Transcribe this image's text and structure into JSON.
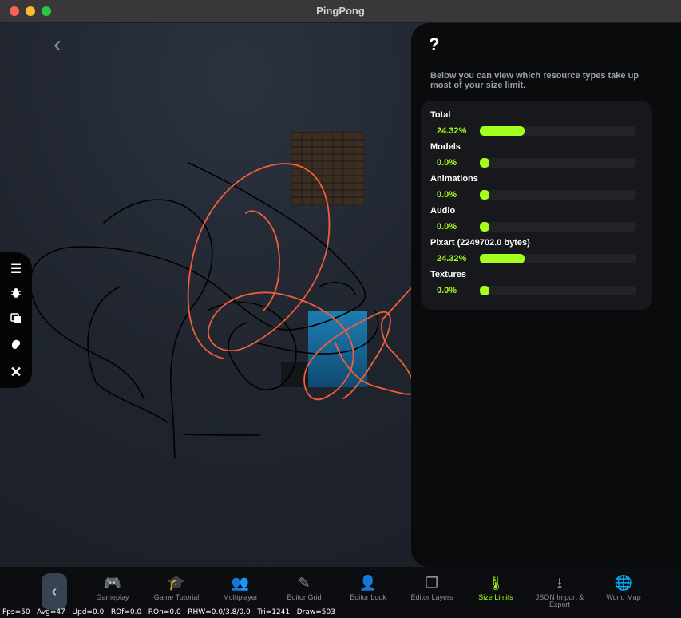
{
  "window": {
    "title": "PingPong"
  },
  "panel": {
    "help_label": "?",
    "description": "Below you can view which resource types take up most of your size limit.",
    "rows": [
      {
        "label": "Total",
        "percent_text": "24.32%",
        "fill_fraction": 0.2432
      },
      {
        "label": "Models",
        "percent_text": "0.0%",
        "fill_fraction": 0.0
      },
      {
        "label": "Animations",
        "percent_text": "0.0%",
        "fill_fraction": 0.0
      },
      {
        "label": "Audio",
        "percent_text": "0.0%",
        "fill_fraction": 0.0
      },
      {
        "label": "Pixart (2249702.0 bytes)",
        "percent_text": "24.32%",
        "fill_fraction": 0.2432
      },
      {
        "label": "Textures",
        "percent_text": "0.0%",
        "fill_fraction": 0.0
      }
    ],
    "accent_color": "#a4ff1c"
  },
  "side_toolbar": {
    "icons": [
      "menu-icon",
      "bug-icon",
      "copy-icon",
      "paint-icon",
      "close-icon"
    ]
  },
  "nav": {
    "back_icon": "chevron-left-icon",
    "items": [
      {
        "label": "Gameplay",
        "icon": "gamepad-icon"
      },
      {
        "label": "Game Tutorial",
        "icon": "graduation-cap-icon"
      },
      {
        "label": "Multiplayer",
        "icon": "users-icon"
      },
      {
        "label": "Editor Grid",
        "icon": "grid-edit-icon"
      },
      {
        "label": "Editor Look",
        "icon": "user-edit-icon"
      },
      {
        "label": "Editor Layers",
        "icon": "layers-icon"
      },
      {
        "label": "Size Limits",
        "icon": "thermometer-icon"
      },
      {
        "label": "JSON Import & Export",
        "icon": "download-icon"
      },
      {
        "label": "World Map",
        "icon": "globe-icon"
      }
    ],
    "active": "Size Limits"
  },
  "stats": "Fps=50   Avg=47   Upd=0.0   ROf=0.0   ROn=0.0   RHW=0.0/3.8/0.0   Tri=1241   Draw=503"
}
